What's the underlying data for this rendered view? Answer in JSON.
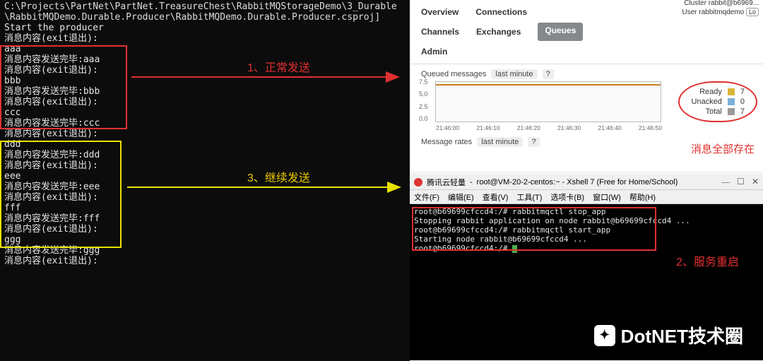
{
  "terminal": {
    "path_line": "C:\\Projects\\PartNet\\PartNet.TreasureChest\\RabbitMQStorageDemo\\3_Durable\\RabbitMQDemo.Durable.Producer\\RabbitMQDemo.Durable.Producer.csproj]",
    "start": "Start the producer",
    "prompt_exit": "消息内容(exit退出):",
    "sent_prefix": "消息内容发送完毕:",
    "block1": [
      "aaa",
      "bbb",
      "ccc"
    ],
    "block2": [
      "ddd",
      "eee",
      "fff",
      "ggg"
    ]
  },
  "annotations": {
    "send1": "1、正常发送",
    "send3": "3、继续发送",
    "restart": "2、服务重启",
    "all_exist": "消息全部存在"
  },
  "browser": {
    "cluster_label": "Cluster",
    "cluster_value": "rabbit@b6969...",
    "user_label": "User",
    "user_value": "rabbitmqdemo",
    "user_badge": "Lo",
    "tabs": {
      "overview": "Overview",
      "connections": "Connections",
      "channels": "Channels",
      "exchanges": "Exchanges",
      "queues": "Queues",
      "admin": "Admin"
    },
    "queued_label": "Queued messages",
    "last_minute": "last minute",
    "help": "?",
    "msg_rates_label": "Message rates",
    "legend": {
      "ready": "Ready",
      "ready_val": "7",
      "unacked": "Unacked",
      "unacked_val": "0",
      "total": "Total",
      "total_val": "7"
    }
  },
  "chart_data": {
    "type": "line",
    "title": "Queued messages last minute",
    "xlabel": "",
    "ylabel": "",
    "ylim": [
      0,
      7.5
    ],
    "y_ticks": [
      "7.5",
      "5.0",
      "2.5",
      "0.0"
    ],
    "categories": [
      "21:46:00",
      "21:46:10",
      "21:46:20",
      "21:46:30",
      "21:46:40",
      "21:46:50"
    ],
    "series": [
      {
        "name": "Ready",
        "values": [
          7,
          7,
          7,
          7,
          7,
          7
        ]
      },
      {
        "name": "Unacked",
        "values": [
          0,
          0,
          0,
          0,
          0,
          0
        ]
      },
      {
        "name": "Total",
        "values": [
          7,
          7,
          7,
          7,
          7,
          7
        ]
      }
    ]
  },
  "xshell": {
    "title_prefix": "腾讯云轻量",
    "title": "root@VM-20-2-centos:~ - Xshell 7 (Free for Home/School)",
    "menus": [
      "文件(F)",
      "编辑(E)",
      "查看(V)",
      "工具(T)",
      "选项卡(B)",
      "窗口(W)",
      "帮助(H)"
    ],
    "lines": [
      "root@b69699cfccd4:/# rabbitmqctl stop_app",
      "Stopping rabbit application on node rabbit@b69699cfccd4 ...",
      "root@b69699cfccd4:/# rabbitmqctl start_app",
      "Starting node rabbit@b69699cfccd4 ...",
      "root@b69699cfccd4:/#"
    ],
    "win_btns": {
      "min": "—",
      "max": "☐",
      "close": "✕"
    }
  },
  "watermark": "DotNET技术圈"
}
